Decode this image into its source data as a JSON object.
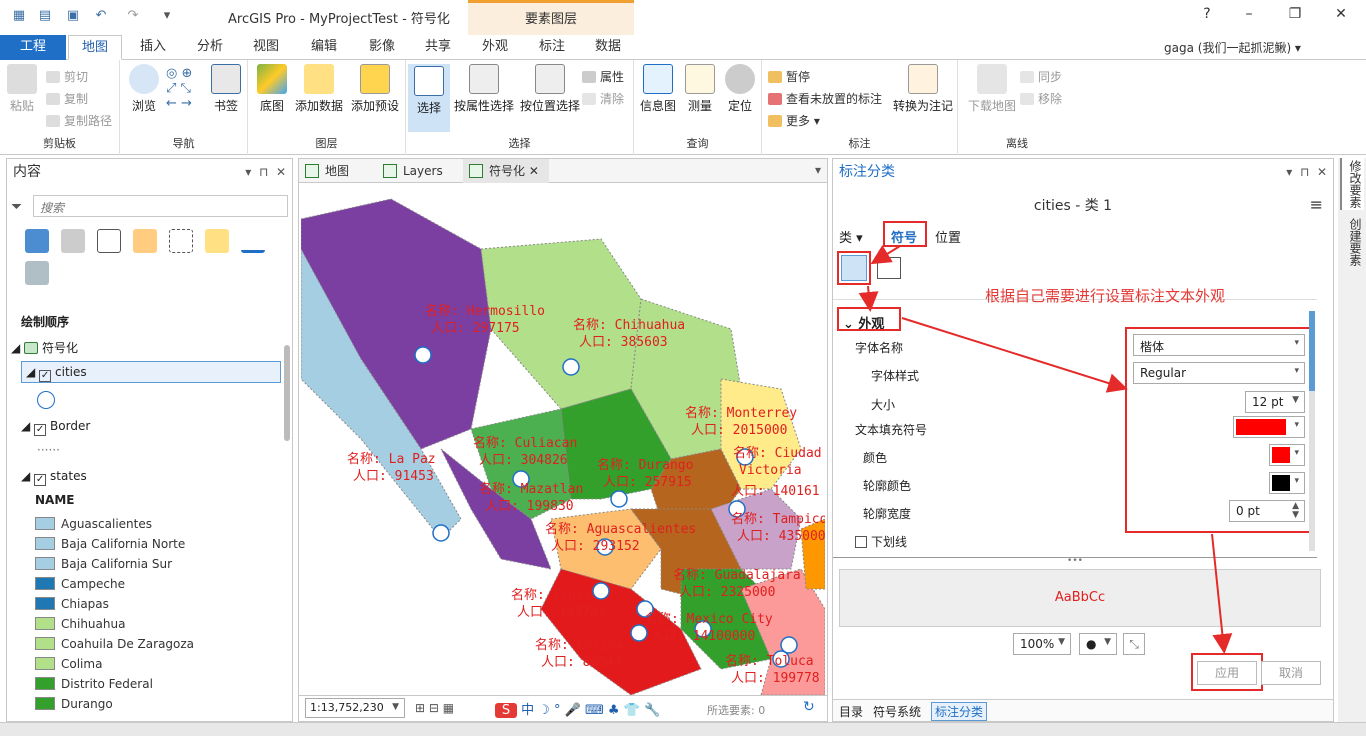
{
  "title": "ArcGIS Pro - MyProjectTest - 符号化",
  "context_tab_group": "要素图层",
  "help": "?",
  "user": "gaga (我们一起抓泥鳅) ▾",
  "tabs": [
    "工程",
    "地图",
    "插入",
    "分析",
    "视图",
    "编辑",
    "影像",
    "共享",
    "外观",
    "标注",
    "数据"
  ],
  "ribbon": {
    "clipboard": {
      "label": "剪贴板",
      "paste": "粘贴",
      "cut": "剪切",
      "copy": "复制",
      "copy_path": "复制路径"
    },
    "navigate": {
      "label": "导航",
      "browse": "浏览",
      "bookmark": "书签"
    },
    "layer": {
      "label": "图层",
      "basemap": "底图",
      "add_data": "添加数据",
      "add_preset": "添加预设"
    },
    "selection": {
      "label": "选择",
      "select": "选择",
      "by_attr": "按属性选择",
      "by_loc": "按位置选择",
      "attributes": "属性",
      "clear": "清除"
    },
    "inquiry": {
      "label": "查询",
      "info": "信息图",
      "measure": "测量",
      "locate": "定位"
    },
    "labeling": {
      "label": "标注",
      "pause": "暂停",
      "view_unplaced": "查看未放置的标注",
      "more": "更多",
      "convert": "转换为注记"
    },
    "offline": {
      "label": "离线",
      "download": "下载地图",
      "sync": "同步",
      "remove": "移除"
    }
  },
  "contents": {
    "title": "内容",
    "search_placeholder": "搜索",
    "drawing_order": "绘制顺序",
    "map_name": "符号化",
    "layers": [
      {
        "name": "cities"
      },
      {
        "name": "Border"
      },
      {
        "name": "states"
      }
    ],
    "field": "NAME",
    "legend": [
      {
        "name": "Aguascalientes",
        "color": "#a6cee3"
      },
      {
        "name": "Baja California Norte",
        "color": "#a6cee3"
      },
      {
        "name": "Baja California Sur",
        "color": "#a6cee3"
      },
      {
        "name": "Campeche",
        "color": "#1f78b4"
      },
      {
        "name": "Chiapas",
        "color": "#1f78b4"
      },
      {
        "name": "Chihuahua",
        "color": "#b2df8a"
      },
      {
        "name": "Coahuila De Zaragoza",
        "color": "#b2df8a"
      },
      {
        "name": "Colima",
        "color": "#b2df8a"
      },
      {
        "name": "Distrito Federal",
        "color": "#33a02c"
      },
      {
        "name": "Durango",
        "color": "#33a02c"
      }
    ]
  },
  "map_tabs": [
    "地图",
    "Layers",
    "符号化"
  ],
  "map_labels": [
    {
      "name": "名称: Hermosillo",
      "pop": "人口: 297175"
    },
    {
      "name": "名称: Chihuahua",
      "pop": "人口: 385603"
    },
    {
      "name": "名称: Monterrey",
      "pop": "人口: 2015000"
    },
    {
      "name": "名称: Culiacan",
      "pop": "人口: 304826"
    },
    {
      "name": "名称: Durango",
      "pop": "人口: 257915"
    },
    {
      "name": "名称: Ciudad",
      "pop": "Victoria"
    },
    {
      "name": "名称: La Paz",
      "pop": "人口: 91453"
    },
    {
      "name": "名称: Mazatlan",
      "pop": "人口: 199830"
    },
    {
      "name": "人口: 140161",
      "pop": ""
    },
    {
      "name": "名称: Tampico",
      "pop": "人口: 435000"
    },
    {
      "name": "名称: Aguascalientes",
      "pop": "人口: 293152"
    },
    {
      "name": "名称: Guadalajara",
      "pop": "人口: 2325000"
    },
    {
      "name": "名称: Tepic",
      "pop": "人口: 145741"
    },
    {
      "name": "名称: Mexico City",
      "pop": "人口: 14100000"
    },
    {
      "name": "名称: Colima",
      "pop": "人口: 86044"
    },
    {
      "name": "名称: Toluca",
      "pop": "人口: 199778"
    }
  ],
  "status": {
    "scale": "1:13,752,230",
    "selected": "所选要素: 0"
  },
  "label_class": {
    "title": "标注分类",
    "class_name": "cities - 类 1",
    "subtabs": [
      "类 ▾",
      "符号",
      "位置"
    ],
    "section": "外观",
    "annotation": "根据自己需要进行设置标注文本外观",
    "font_name_label": "字体名称",
    "font_name": "楷体",
    "font_style_label": "字体样式",
    "font_style": "Regular",
    "size_label": "大小",
    "size": "12 pt",
    "fill_label": "文本填充符号",
    "color_label": "颜色",
    "outline_color_label": "轮廓颜色",
    "outline_width_label": "轮廓宽度",
    "outline_width": "0 pt",
    "underline_label": "下划线",
    "preview_text": "AaBbCc",
    "zoom": "100%",
    "apply": "应用",
    "cancel": "取消",
    "fill_color": "#ff0000",
    "text_color": "#ff0000",
    "outline_color": "#000000"
  },
  "bottom_tabs": [
    "目录",
    "符号系统",
    "标注分类"
  ],
  "right_tabs": [
    "修改要素",
    "创建要素"
  ]
}
